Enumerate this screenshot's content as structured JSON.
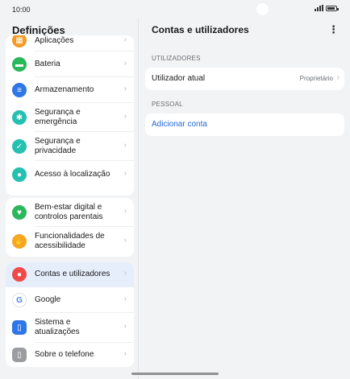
{
  "status": {
    "time": "10:00"
  },
  "left": {
    "title": "Definições",
    "items": [
      {
        "label": "Aplicações",
        "icon": "apps-icon",
        "color": "#f59a23",
        "glyph": "▦"
      },
      {
        "label": "Bateria",
        "icon": "battery-icon",
        "color": "#2bb75b",
        "glyph": "▬"
      },
      {
        "label": "Armazenamento",
        "icon": "storage-icon",
        "color": "#2f76e6",
        "glyph": "≡"
      },
      {
        "label": "Segurança e emergência",
        "icon": "emergency-icon",
        "color": "#25c0b0",
        "glyph": "✱"
      },
      {
        "label": "Segurança e privacidade",
        "icon": "shield-icon",
        "color": "#25c0b0",
        "glyph": "✓"
      },
      {
        "label": "Acesso à localização",
        "icon": "location-icon",
        "color": "#25c0b0",
        "glyph": "●"
      },
      {
        "label": "Bem-estar digital e controlos parentais",
        "icon": "wellbeing-icon",
        "color": "#2bb75b",
        "glyph": "♥"
      },
      {
        "label": "Funcionalidades de acessibilidade",
        "icon": "accessibility-icon",
        "color": "#f5a623",
        "glyph": "✋"
      },
      {
        "label": "Contas e utilizadores",
        "icon": "account-icon",
        "color": "#ef4a4a",
        "glyph": "●"
      },
      {
        "label": "Google",
        "icon": "google-icon",
        "color": "#4285f4",
        "glyph": "G"
      },
      {
        "label": "Sistema e atualizações",
        "icon": "system-icon",
        "color": "#2f76e6",
        "glyph": "▯"
      },
      {
        "label": "Sobre o telefone",
        "icon": "phone-info-icon",
        "color": "#9a9ca0",
        "glyph": "▯"
      }
    ]
  },
  "right": {
    "title": "Contas e utilizadores",
    "section_users": "UTILIZADORES",
    "current_user_label": "Utilizador atual",
    "current_user_value": "Proprietário",
    "section_personal": "PESSOAL",
    "add_account": "Adicionar conta"
  }
}
